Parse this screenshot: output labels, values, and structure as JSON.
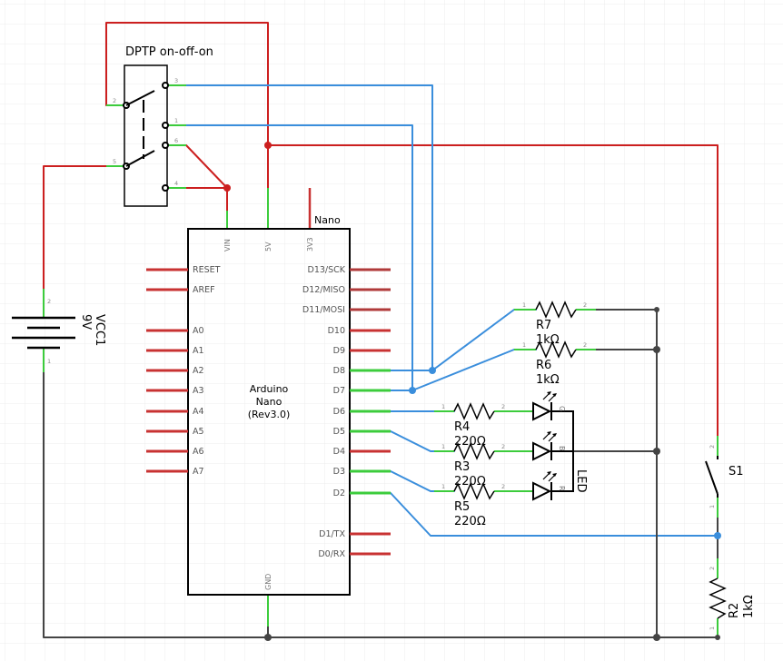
{
  "colors": {
    "grid": "#e6e6e6",
    "wire_red": "#cc1f1f",
    "wire_blue": "#3a8edc",
    "wire_dark": "#444444",
    "pin_green": "#3ccc3c",
    "pin_red": "#c83232",
    "body": "#000000"
  },
  "switch_dptp": {
    "label": "DPTP on-off-on",
    "pins": [
      "2",
      "3",
      "1",
      "5",
      "6",
      "4"
    ]
  },
  "arduino": {
    "name": "Arduino",
    "model": "Nano",
    "rev": "(Rev3.0)",
    "top_label": "Nano",
    "top_pins": [
      "VIN",
      "5V",
      "3V3"
    ],
    "bottom_pin": "GND",
    "left_pins": [
      "RESET",
      "AREF",
      "A0",
      "A1",
      "A2",
      "A3",
      "A4",
      "A5",
      "A6",
      "A7"
    ],
    "right_pins": [
      "D13/SCK",
      "D12/MISO",
      "D11/MOSI",
      "D10",
      "D9",
      "D8",
      "D7",
      "D6",
      "D5",
      "D4",
      "D3",
      "D2",
      "D1/TX",
      "D0/RX"
    ]
  },
  "battery": {
    "name": "VCC1",
    "value": "9V",
    "pin_top": "2",
    "pin_bottom": "1"
  },
  "resistors": {
    "r7": {
      "name": "R7",
      "value": "1kΩ",
      "p1": "1",
      "p2": "2"
    },
    "r6": {
      "name": "R6",
      "value": "1kΩ",
      "p1": "1",
      "p2": "2"
    },
    "r4": {
      "name": "R4",
      "value": "220Ω",
      "p1": "1",
      "p2": "2"
    },
    "r3": {
      "name": "R3",
      "value": "220Ω",
      "p1": "1",
      "p2": "2"
    },
    "r5": {
      "name": "R5",
      "value": "220Ω",
      "p1": "1",
      "p2": "2"
    },
    "r2": {
      "name": "R2",
      "value": "1kΩ",
      "p1": "1",
      "p2": "2"
    }
  },
  "led": {
    "name": "LED",
    "pins": [
      "G",
      "B",
      "R"
    ]
  },
  "switch_s1": {
    "name": "S1",
    "pin_top": "2",
    "pin_bottom": "1"
  }
}
